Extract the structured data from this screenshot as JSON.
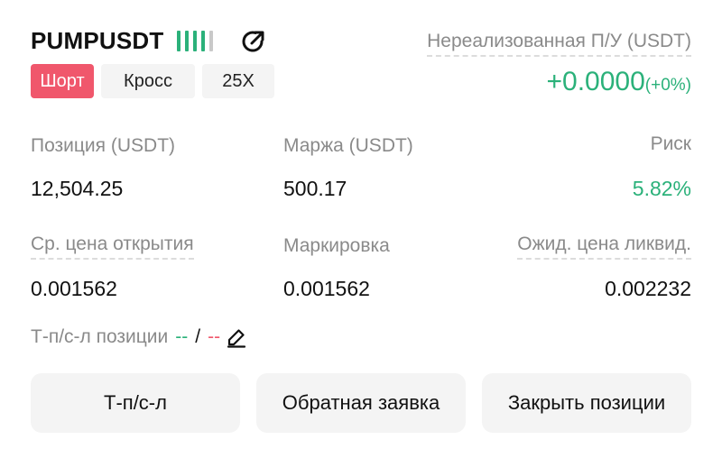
{
  "header": {
    "symbol": "PUMPUSDT",
    "share_icon": "share-arrow-icon",
    "tags": {
      "side": "Шорт",
      "margin_mode": "Кросс",
      "leverage": "25X"
    },
    "unrealized_pnl_label": "Нереализованная П/У (USDT)",
    "unrealized_pnl_value": "+0.0000",
    "unrealized_pnl_percent": "(+0%)"
  },
  "metrics": {
    "position_label": "Позиция (USDT)",
    "position_value": "12,504.25",
    "margin_label": "Маржа (USDT)",
    "margin_value": "500.17",
    "risk_label": "Риск",
    "risk_value": "5.82%",
    "avg_open_label": "Ср. цена открытия",
    "avg_open_value": "0.001562",
    "mark_label": "Маркировка",
    "mark_value": "0.001562",
    "liq_label": "Ожид. цена ликвид.",
    "liq_value": "0.002232"
  },
  "tpsl": {
    "label": "Т-п/с-л позиции",
    "tp": "--",
    "separator": "/",
    "sl": "--",
    "edit_icon": "pencil-icon"
  },
  "buttons": {
    "tpsl": "Т-п/с-л",
    "reverse": "Обратная заявка",
    "close": "Закрыть позиции"
  },
  "colors": {
    "green": "#2bb17a",
    "red": "#f0576c",
    "muted": "#8a8a8a",
    "button_bg": "#f4f4f4"
  }
}
